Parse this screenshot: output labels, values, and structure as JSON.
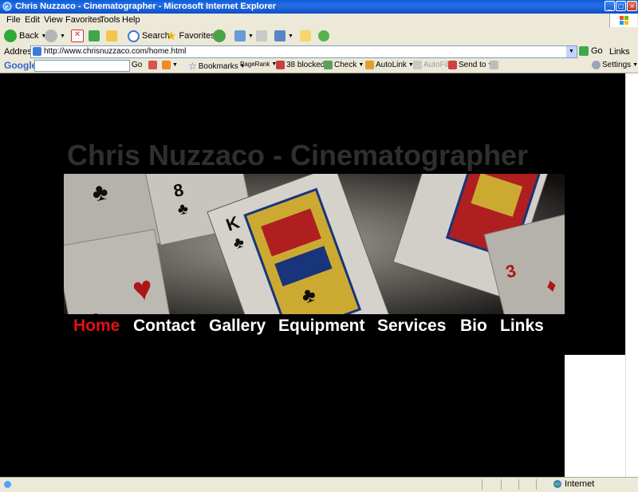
{
  "window": {
    "title": "Chris Nuzzaco - Cinematographer - Microsoft Internet Explorer"
  },
  "menu": [
    "File",
    "Edit",
    "View",
    "Favorites",
    "Tools",
    "Help"
  ],
  "toolbar": {
    "back": "Back",
    "search": "Search",
    "favorites": "Favorites"
  },
  "address": {
    "label": "Address",
    "url": "http://www.chrisnuzzaco.com/home.html",
    "go": "Go",
    "links": "Links"
  },
  "google_toolbar": {
    "logo": "Google",
    "go": "Go",
    "bookmarks": "Bookmarks",
    "pagerank": "PageRank",
    "blocked": "38 blocked",
    "check": "Check",
    "autolink": "AutoLink",
    "autofill": "AutoFill",
    "send_to": "Send to",
    "settings": "Settings"
  },
  "site": {
    "title": "Chris Nuzzaco - Cinematographer",
    "nav": [
      {
        "label": "Home",
        "active": true
      },
      {
        "label": "Contact",
        "active": false
      },
      {
        "label": "Gallery",
        "active": false
      },
      {
        "label": "Equipment",
        "active": false
      },
      {
        "label": "Services",
        "active": false
      },
      {
        "label": "Bio",
        "active": false
      },
      {
        "label": "Links",
        "active": false
      }
    ]
  },
  "status": {
    "zone": "Internet"
  },
  "colors": {
    "active_nav": "#e01010",
    "nav": "#ffffff",
    "title": "#2f2f2f",
    "background": "#000000"
  }
}
